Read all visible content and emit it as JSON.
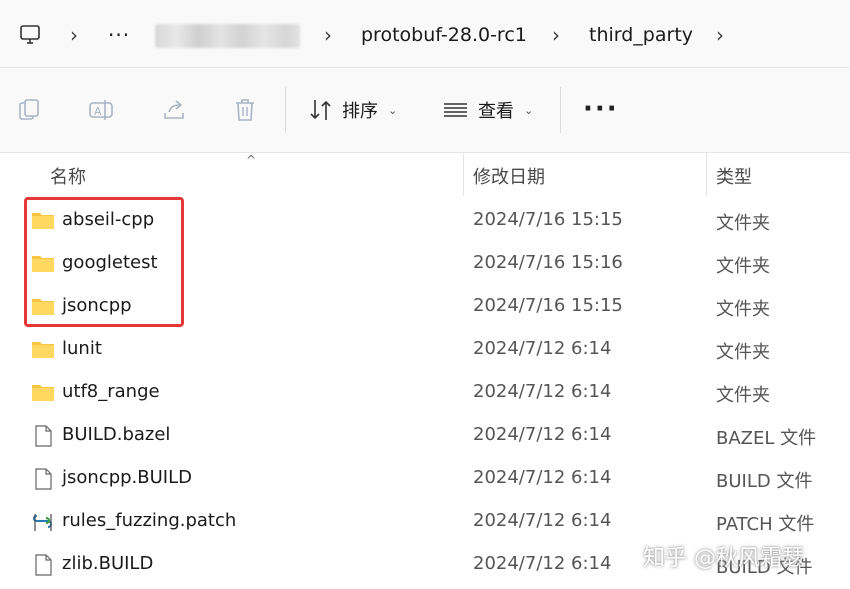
{
  "address_bar": {
    "computer_icon": "computer-icon",
    "overflow_label": "···",
    "path": [
      "protobuf-28.0-rc1",
      "third_party"
    ]
  },
  "toolbar": {
    "icons": [
      "copy-icon",
      "rename-icon",
      "share-icon",
      "delete-icon"
    ],
    "sort_label": "排序",
    "view_label": "查看",
    "more_label": "···"
  },
  "columns": {
    "name": "名称",
    "date": "修改日期",
    "type": "类型"
  },
  "files": [
    {
      "name": "abseil-cpp",
      "date": "2024/7/16 15:15",
      "type": "文件夹",
      "icon": "folder-icon"
    },
    {
      "name": "googletest",
      "date": "2024/7/16 15:16",
      "type": "文件夹",
      "icon": "folder-icon"
    },
    {
      "name": "jsoncpp",
      "date": "2024/7/16 15:15",
      "type": "文件夹",
      "icon": "folder-icon"
    },
    {
      "name": "lunit",
      "date": "2024/7/12 6:14",
      "type": "文件夹",
      "icon": "folder-icon"
    },
    {
      "name": "utf8_range",
      "date": "2024/7/12 6:14",
      "type": "文件夹",
      "icon": "folder-icon"
    },
    {
      "name": "BUILD.bazel",
      "date": "2024/7/12 6:14",
      "type": "BAZEL 文件",
      "icon": "file-icon"
    },
    {
      "name": "jsoncpp.BUILD",
      "date": "2024/7/12 6:14",
      "type": "BUILD 文件",
      "icon": "file-icon"
    },
    {
      "name": "rules_fuzzing.patch",
      "date": "2024/7/12 6:14",
      "type": "PATCH 文件",
      "icon": "patch-file-icon"
    },
    {
      "name": "zlib.BUILD",
      "date": "2024/7/12 6:14",
      "type": "BUILD 文件",
      "icon": "file-icon"
    }
  ],
  "watermark": "知乎 @秋风霜瑟",
  "colors": {
    "highlight_border": "#e53935",
    "folder": "#f6c543"
  }
}
